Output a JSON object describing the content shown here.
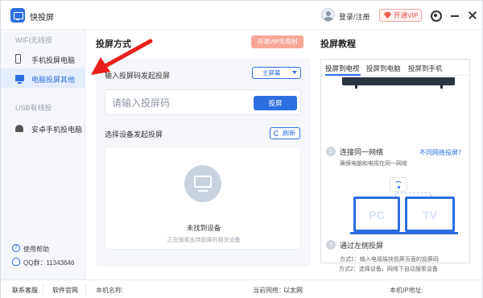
{
  "app": {
    "title": "快投屏"
  },
  "header": {
    "login_label": "登录/注册",
    "vip_label": "开通VIP"
  },
  "sidebar": {
    "sections": [
      {
        "title": "WIFI无线投"
      },
      {
        "title": "USB有线投"
      }
    ],
    "items": [
      {
        "label": "手机投屏电脑",
        "icon": "phone-icon"
      },
      {
        "label": "电脑投屏其他",
        "icon": "monitor-icon",
        "active": true
      },
      {
        "label": "安卓手机投电脑",
        "icon": "android-icon"
      }
    ],
    "help_label": "使用帮助",
    "qq_label": "QQ群：11343646"
  },
  "cast": {
    "title": "投屏方式",
    "vip_unlimited_label": "开通VIP无限制",
    "code_label": "输入投屏码发起投屏",
    "mode_value": "主屏幕",
    "code_placeholder": "请输入投屏码",
    "cast_button": "投屏",
    "device_label": "选择设备发起投屏",
    "refresh_label": "刷新",
    "empty_title": "未找到设备",
    "empty_sub": "正在搜索支持投屏的相关设备"
  },
  "tutorial": {
    "title": "投屏教程",
    "tabs": [
      "投屏到电视",
      "投屏到电脑",
      "投屏到手机"
    ],
    "tv_strip_text": "",
    "step2": {
      "num": "2",
      "title": "连接同一网络",
      "desc": "确保电脑和电视在同一网络",
      "link": "不同网络投屏？"
    },
    "device_left": "PC",
    "device_right": "TV",
    "step3": {
      "num": "3",
      "title": "通过左侧投屏",
      "desc1": "方式1：输入电视端快投屏页面的投屏码",
      "desc2": "方式2：选择设备，网络下自动搜索设备"
    }
  },
  "footer": {
    "contact": "联系客服",
    "website": "软件官网",
    "machine_name_label": "本机名称:",
    "network_label": "当前网络：",
    "network_value": "以太网",
    "ip_label": "本机IP地址:"
  },
  "colors": {
    "accent": "#2d6fe0",
    "vip": "#e2554a",
    "vip_unlimited_bg": "#f8a797",
    "annotation_arrow": "#e8201b"
  }
}
